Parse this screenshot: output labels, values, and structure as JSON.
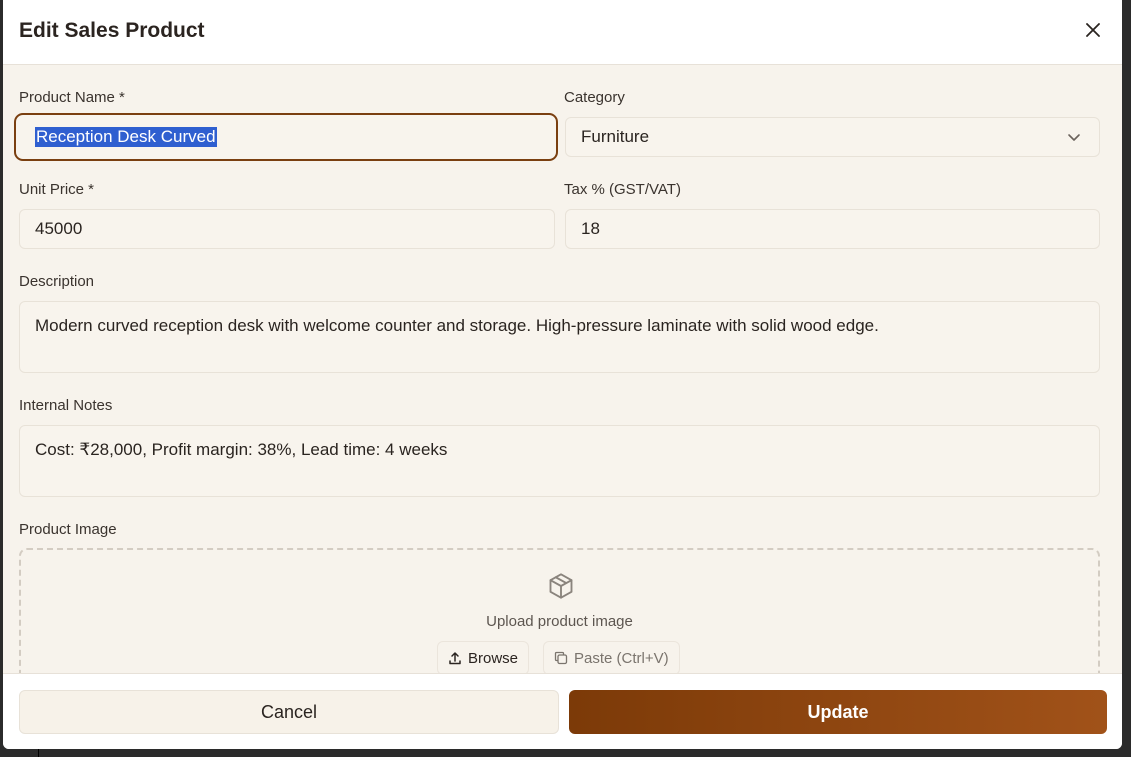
{
  "dialog": {
    "title": "Edit Sales Product"
  },
  "form": {
    "product_name": {
      "label": "Product Name *",
      "value": "Reception Desk Curved"
    },
    "category": {
      "label": "Category",
      "value": "Furniture"
    },
    "unit_price": {
      "label": "Unit Price *",
      "value": "45000"
    },
    "tax": {
      "label": "Tax % (GST/VAT)",
      "value": "18"
    },
    "description": {
      "label": "Description",
      "value": "Modern curved reception desk with welcome counter and storage. High-pressure laminate with solid wood edge."
    },
    "internal_notes": {
      "label": "Internal Notes",
      "value": "Cost: ₹28,000, Profit margin: 38%, Lead time: 4 weeks"
    },
    "product_image": {
      "label": "Product Image",
      "upload_text": "Upload product image",
      "browse_label": "Browse",
      "paste_label": "Paste (Ctrl+V)"
    }
  },
  "footer": {
    "cancel_label": "Cancel",
    "update_label": "Update"
  },
  "colors": {
    "accent": "#7c3a08",
    "accent_end": "#a15219",
    "background": "#f7f3ec",
    "selection": "#2f5fd0"
  },
  "icons": [
    "close-icon",
    "chevron-down-icon",
    "package-icon",
    "upload-icon",
    "copy-icon"
  ]
}
